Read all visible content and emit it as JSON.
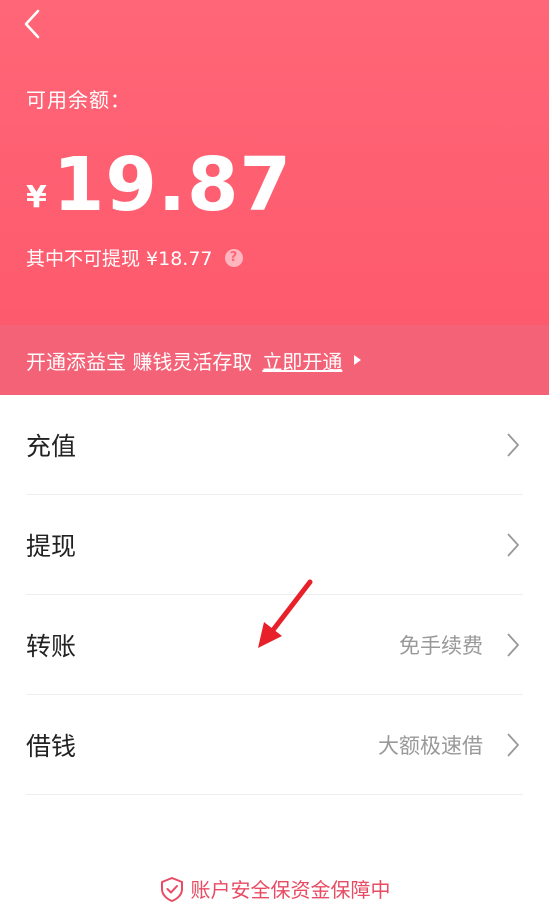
{
  "header": {
    "back_icon": "back-arrow-icon",
    "balance_label": "可用余额：",
    "currency_symbol": "¥",
    "amount": "19.87",
    "non_withdrawable_text": "其中不可提现 ¥18.77",
    "help_icon": "question-icon",
    "help_symbol": "?"
  },
  "banner": {
    "text": "开通添益宝 赚钱灵活存取",
    "link": "立即开通"
  },
  "list": {
    "items": [
      {
        "label": "充值",
        "hint": ""
      },
      {
        "label": "提现",
        "hint": ""
      },
      {
        "label": "转账",
        "hint": "免手续费"
      },
      {
        "label": "借钱",
        "hint": "大额极速借"
      }
    ]
  },
  "footer": {
    "icon": "shield-check-icon",
    "text": "账户安全保资金保障中"
  },
  "colors": {
    "header_bg": "#ff6677",
    "banner_bg": "#f36276",
    "footer_text": "#e84b62",
    "annotation_arrow": "#e8202a"
  }
}
